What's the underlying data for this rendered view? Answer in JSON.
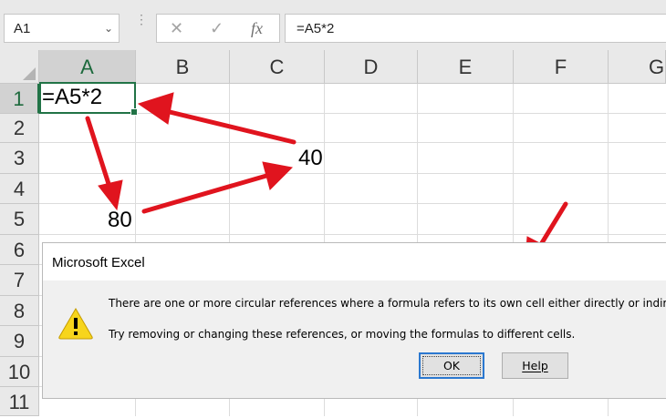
{
  "formula_bar": {
    "name_box": "A1",
    "name_box_chevron": "⌄",
    "cancel_icon": "✕",
    "enter_icon": "✓",
    "fx_label": "fx",
    "formula": "=A5*2"
  },
  "grid": {
    "columns": [
      "A",
      "B",
      "C",
      "D",
      "E",
      "F",
      "G"
    ],
    "rows": [
      "1",
      "2",
      "3",
      "4",
      "5",
      "6",
      "7",
      "8",
      "9",
      "10",
      "11"
    ],
    "selected_cell": "A1",
    "cells": {
      "A1": "=A5*2",
      "C3": "40",
      "B5": "80"
    }
  },
  "dialog": {
    "title": "Microsoft Excel",
    "icon": "warning-icon",
    "message_line1": "There are one or more circular references where a formula refers to its own cell either directly or indirectly.",
    "message_line2": "Try removing or changing these references, or moving the formulas to different cells.",
    "ok_label": "OK",
    "help_label": "Help"
  },
  "colors": {
    "accent_green": "#217346",
    "arrow_red": "#e0141e",
    "warning_yellow": "#f7d51c"
  }
}
